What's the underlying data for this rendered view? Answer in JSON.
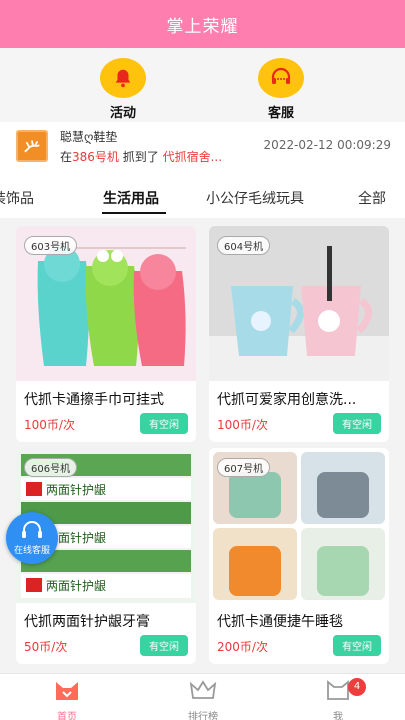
{
  "header": {
    "title": "掌上荣耀"
  },
  "actions": [
    {
      "label": "活动",
      "icon": "bell-icon"
    },
    {
      "label": "客服",
      "icon": "headset-icon"
    }
  ],
  "notice": {
    "name": "聪慧ღ鞋垫",
    "msg_prefix": "在",
    "machine": "386号机",
    "msg_middle": " 抓到了 ",
    "prize": "代抓宿舍...",
    "time": "2022-02-12 00:09:29"
  },
  "tabs": [
    "装饰品",
    "生活用品",
    "小公仔毛绒玩具",
    "全部"
  ],
  "active_tab": "生活用品",
  "products": [
    {
      "tag": "603号机",
      "title": "代抓卡通擦手巾可挂式",
      "price": "100币/次",
      "status": "有空闲"
    },
    {
      "tag": "604号机",
      "title": "代抓可爱家用创意洗...",
      "price": "100币/次",
      "status": "有空闲"
    },
    {
      "tag": "606号机",
      "title": "代抓两面针护龈牙膏",
      "price": "50币/次",
      "status": "有空闲"
    },
    {
      "tag": "607号机",
      "title": "代抓卡通便捷午睡毯",
      "price": "200币/次",
      "status": "有空闲"
    }
  ],
  "float_service": {
    "label": "在线客服"
  },
  "bottom_nav": [
    {
      "label": "首页",
      "icon": "cat-home-icon",
      "active": true
    },
    {
      "label": "排行榜",
      "icon": "crown-icon",
      "active": false
    },
    {
      "label": "我",
      "icon": "cat-profile-icon",
      "active": false,
      "badge": "4"
    }
  ],
  "colors": {
    "header": "#ff7eb0",
    "accent_yellow": "#ffc20d",
    "price_red": "#e83b3b",
    "status_green": "#39d3a2"
  }
}
